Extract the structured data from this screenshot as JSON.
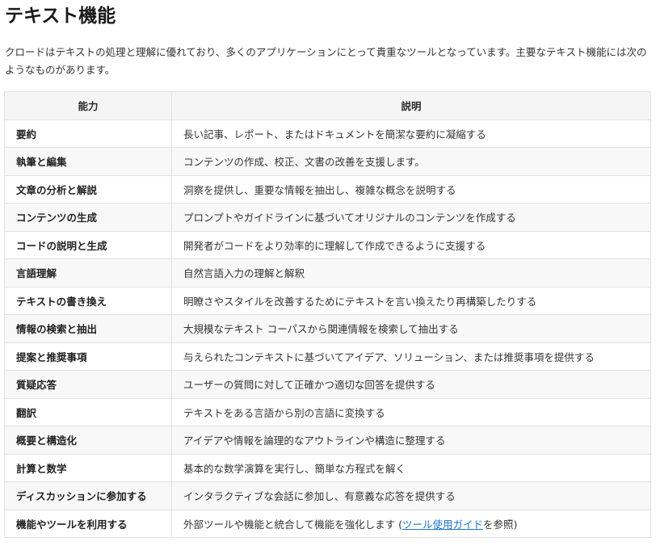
{
  "title": "テキスト機能",
  "intro": "クロードはテキストの処理と理解に優れており、多くのアプリケーションにとって貴重なツールとなっています。主要なテキスト機能には次のようなものがあります。",
  "table": {
    "headers": [
      "能力",
      "説明"
    ],
    "rows": [
      {
        "capability": "要約",
        "description": "長い記事、レポート、またはドキュメントを簡潔な要約に凝縮する"
      },
      {
        "capability": "執筆と編集",
        "description": "コンテンツの作成、校正、文書の改善を支援します。"
      },
      {
        "capability": "文章の分析と解説",
        "description": "洞察を提供し、重要な情報を抽出し、複雑な概念を説明する"
      },
      {
        "capability": "コンテンツの生成",
        "description": "プロンプトやガイドラインに基づいてオリジナルのコンテンツを作成する"
      },
      {
        "capability": "コードの説明と生成",
        "description": "開発者がコードをより効率的に理解して作成できるように支援する"
      },
      {
        "capability": "言語理解",
        "description": "自然言語入力の理解と解釈"
      },
      {
        "capability": "テキストの書き換え",
        "description": "明瞭さやスタイルを改善するためにテキストを言い換えたり再構築したりする"
      },
      {
        "capability": "情報の検索と抽出",
        "description": "大規模なテキスト コーパスから関連情報を検索して抽出する"
      },
      {
        "capability": "提案と推奨事項",
        "description": "与えられたコンテキストに基づいてアイデア、ソリューション、または推奨事項を提供する"
      },
      {
        "capability": "質疑応答",
        "description": "ユーザーの質問に対して正確かつ適切な回答を提供する"
      },
      {
        "capability": "翻訳",
        "description": "テキストをある言語から別の言語に変換する"
      },
      {
        "capability": "概要と構造化",
        "description": "アイデアや情報を論理的なアウトラインや構造に整理する"
      },
      {
        "capability": "計算と数学",
        "description": "基本的な数学演算を実行し、簡単な方程式を解く"
      },
      {
        "capability": "ディスカッションに参加する",
        "description": "インタラクティブな会話に参加し、有意義な応答を提供する"
      }
    ],
    "last_row": {
      "capability": "機能やツールを利用する",
      "description_prefix": "外部ツールや機能と統合して機能を強化します (",
      "link_text": "ツール使用ガイド",
      "description_suffix": "を参照)"
    }
  }
}
